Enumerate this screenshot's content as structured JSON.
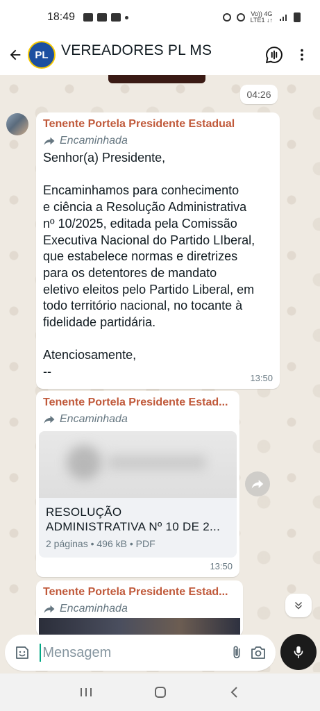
{
  "status_bar": {
    "time": "18:49",
    "network_label_top": "Vo)) 4G",
    "network_label_bottom": "LTE1 ↓↑"
  },
  "header": {
    "avatar_text": "PL",
    "title": "VEREADORES PL MS"
  },
  "messages": {
    "prev_time": "04:26",
    "m1": {
      "sender": "Tenente Portela Presidente Estadual",
      "forwarded_label": "Encaminhada",
      "text": "Senhor(a) Presidente,\n\nEncaminhamos para conhecimento\ne ciência a Resolução Administrativa\nnº 10/2025, editada pela Comissão\nExecutiva Nacional do Partido LIberal,\nque estabelece normas e diretrizes\npara os detentores de mandato\neletivo eleitos pelo Partido Liberal, em\ntodo território nacional, no tocante à\nfidelidade partidária.\n\nAtenciosamente,\n--",
      "time": "13:50"
    },
    "m2": {
      "sender": "Tenente Portela Presidente Estad...",
      "forwarded_label": "Encaminhada",
      "doc_title": "RESOLUÇÃO\nADMINISTRATIVA Nº 10 DE 2...",
      "doc_meta": "2 páginas • 496 kB • PDF",
      "time": "13:50"
    },
    "m3": {
      "sender": "Tenente Portela Presidente Estad...",
      "forwarded_label": "Encaminhada"
    }
  },
  "composer": {
    "placeholder": "Mensagem"
  },
  "icons": {
    "back": "arrow-left-icon",
    "voice_chat": "voice-chat-icon",
    "menu": "more-vert-icon",
    "forward": "forward-arrow-icon",
    "share": "share-icon",
    "scroll_down": "double-chevron-down-icon",
    "emoji": "sticker-icon",
    "attach": "paperclip-icon",
    "camera": "camera-icon",
    "mic": "mic-icon"
  },
  "colors": {
    "sender_name": "#c0593a",
    "wallpaper": "#efeae2",
    "accent": "#00a884",
    "mic_button": "#1b1b1b"
  }
}
